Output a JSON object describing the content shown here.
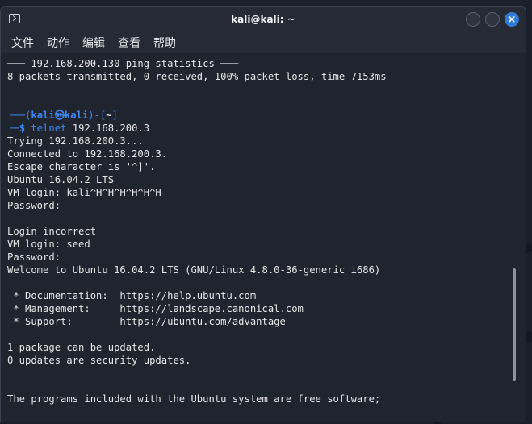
{
  "window": {
    "title": "kali@kali: ~",
    "icon": "terminal-icon",
    "buttons": [
      "minimize-icon",
      "maximize-icon",
      "close-icon"
    ],
    "close_glyph": "×"
  },
  "menu": {
    "items": [
      "文件",
      "动作",
      "编辑",
      "查看",
      "帮助"
    ]
  },
  "terminal": {
    "before_prompt": [
      "─── 192.168.200.130 ping statistics ───",
      "8 packets transmitted, 0 received, 100% packet loss, time 7153ms",
      "",
      ""
    ],
    "prompt": {
      "corner_top": "┌──(",
      "user": "kali",
      "at_symbol": "㉿",
      "host": "kali",
      "close_paren": ")-[",
      "cwd": "~",
      "close_bracket": "]",
      "corner_bottom": "└─",
      "dollar": "$ ",
      "command": "telnet",
      "args": " 192.168.200.3"
    },
    "output": [
      "Trying 192.168.200.3...",
      "Connected to 192.168.200.3.",
      "Escape character is '^]'.",
      "Ubuntu 16.04.2 LTS",
      "VM login: kali^H^H^H^H^H^H",
      "Password:",
      "",
      "Login incorrect",
      "VM login: seed",
      "Password:",
      "Welcome to Ubuntu 16.04.2 LTS (GNU/Linux 4.8.0-36-generic i686)",
      "",
      " * Documentation:  https://help.ubuntu.com",
      " * Management:     https://landscape.canonical.com",
      " * Support:        https://ubuntu.com/advantage",
      "",
      "1 package can be updated.",
      "0 updates are security updates.",
      "",
      "",
      "The programs included with the Ubuntu system are free software;"
    ]
  },
  "colors": {
    "prompt_blue": "#3f86f0",
    "close_button": "#2f7bd6",
    "terminal_bg": "#20242e"
  }
}
